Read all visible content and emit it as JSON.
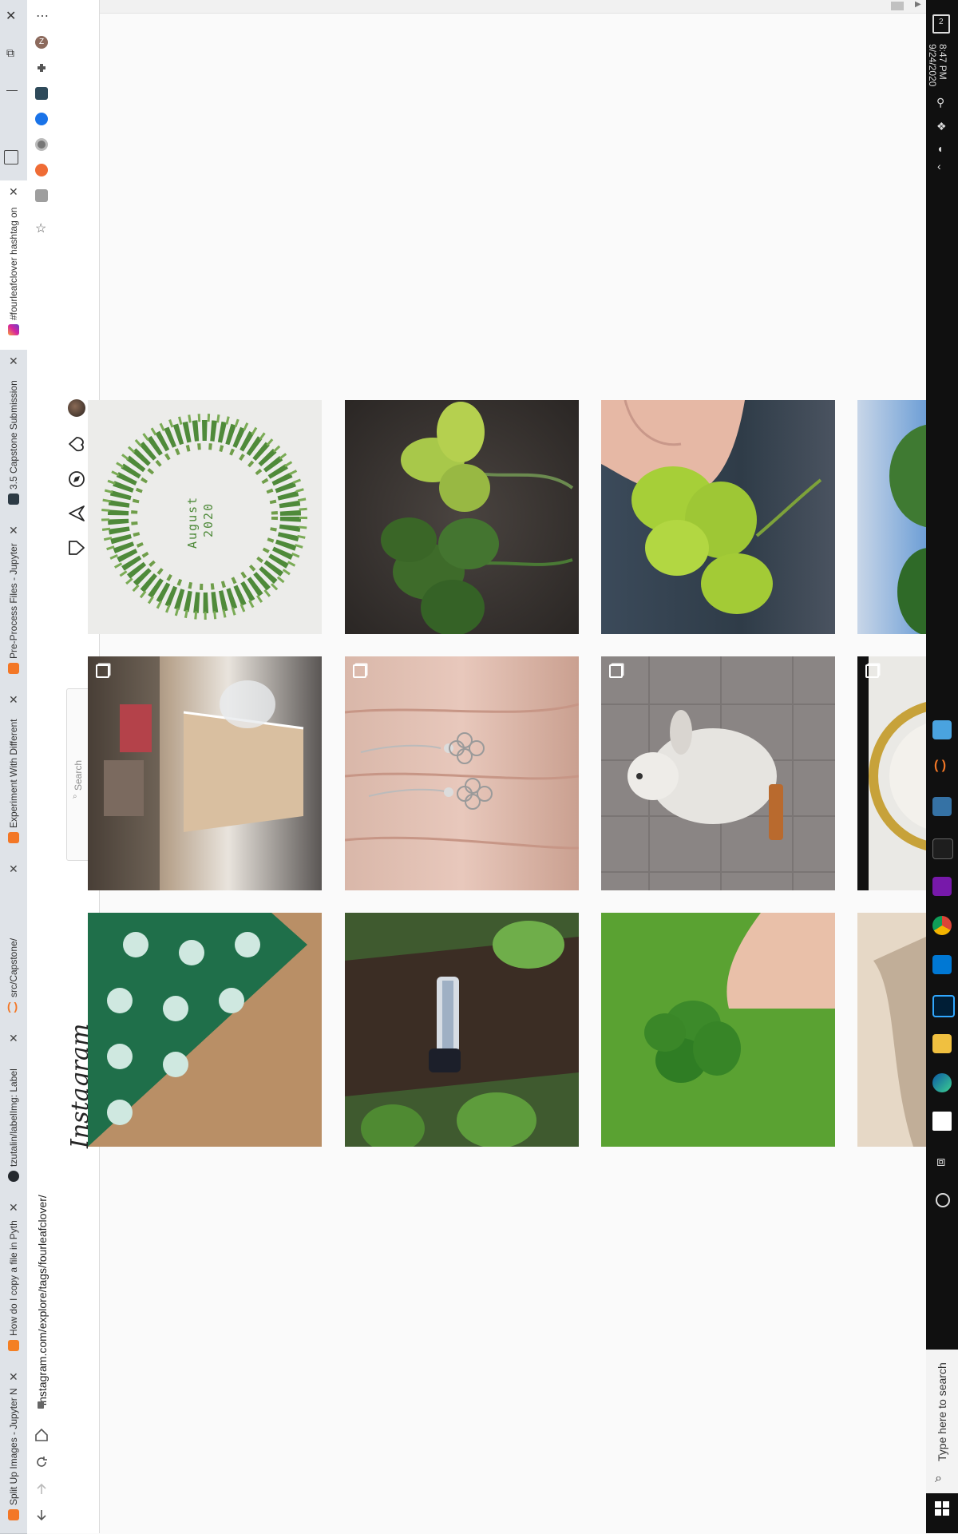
{
  "browser": {
    "tabs": [
      {
        "title": "#fourleafclover hashtag on",
        "active": true
      },
      {
        "title": "3.5 Capstone Submission"
      },
      {
        "title": "Pre-Process Files - Jupyter"
      },
      {
        "title": "Experiment With Different"
      },
      {
        "title": "src/Capstone/"
      },
      {
        "title": "tzutalin/labelImg: Label"
      },
      {
        "title": "How do I copy a file in Pyth"
      },
      {
        "title": "Split Up Images - Jupyter N"
      }
    ],
    "close_glyph": "✕",
    "window_controls": {
      "close": "✕",
      "restore": "⧉",
      "minimize": "—"
    },
    "menu_glyph": "⋯",
    "profile_initial": "Z",
    "url": "instagram.com/explore/tags/fourleafclover/"
  },
  "instagram": {
    "logo_text": "Instagram",
    "search_placeholder": "Search",
    "nav_icons": [
      "home-icon",
      "direct-icon",
      "explore-icon",
      "activity-icon",
      "profile-avatar"
    ],
    "tile_colors": {
      "clover": "#5a8f3a",
      "light": "#a9c46b"
    }
  },
  "grid": [
    [
      {
        "name": "post-clover-wreath",
        "caption_line1": "August",
        "caption_line2": "2020",
        "multi": false
      },
      {
        "name": "post-clover-dark",
        "multi": false
      },
      {
        "name": "post-clover-hand",
        "multi": false
      },
      {
        "name": "post-clover-sky",
        "multi": false
      }
    ],
    [
      {
        "name": "post-iced-drink",
        "multi": true
      },
      {
        "name": "post-clover-earrings",
        "multi": true
      },
      {
        "name": "post-white-rabbit",
        "multi": true
      },
      {
        "name": "post-ceramic-plate",
        "multi": true
      }
    ],
    [
      {
        "name": "post-shamrock-phonecase",
        "multi": false
      },
      {
        "name": "post-bracelet-tree",
        "multi": false
      },
      {
        "name": "post-clover-grass",
        "multi": false
      },
      {
        "name": "post-shadow-sand",
        "multi": false
      }
    ]
  ],
  "taskbar": {
    "time": "8:47 PM",
    "date": "9/24/2020",
    "search_text": "Type here to search",
    "notification_count": "2"
  }
}
